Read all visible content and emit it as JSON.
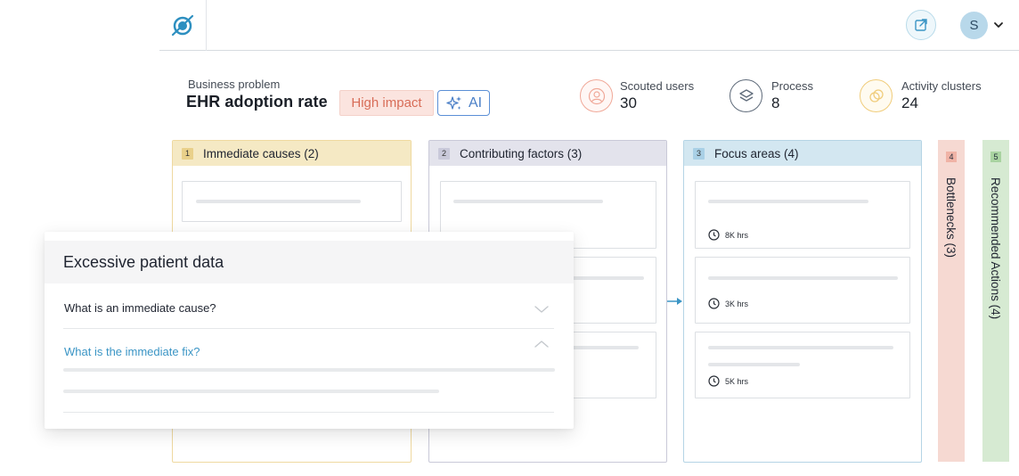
{
  "header": {
    "user_initial": "S"
  },
  "business": {
    "label": "Business problem",
    "title": "EHR adoption rate",
    "impact": "High impact",
    "ai": "AI"
  },
  "stats": [
    {
      "label": "Scouted users",
      "value": "30",
      "icon": "user-icon",
      "color": "#f0a898"
    },
    {
      "label": "Process",
      "value": "8",
      "icon": "layers-icon",
      "color": "#5f6b7a"
    },
    {
      "label": "Activity clusters",
      "value": "24",
      "icon": "clusters-icon",
      "color": "#f0cc7a"
    }
  ],
  "columns": [
    {
      "num": "1",
      "title": "Immediate causes (2)",
      "color": "#f5e9c4",
      "border": "#efd9a0"
    },
    {
      "num": "2",
      "title": "Contributing factors (3)",
      "color": "#e3e3ec",
      "border": "#c9c9d8"
    },
    {
      "num": "3",
      "title": "Focus areas (4)",
      "color": "#d3e7f1",
      "border": "#b5d4e5"
    },
    {
      "num": "4",
      "title": "Bottlenecks (3)",
      "color": "#f6d9d2"
    },
    {
      "num": "5",
      "title": "Recommended Actions (4)",
      "color": "#d6ead2"
    }
  ],
  "focus_cards": [
    {
      "hours": "8K hrs"
    },
    {
      "hours": "3K hrs"
    },
    {
      "hours": "5K hrs"
    }
  ],
  "popup": {
    "title": "Excessive patient data",
    "question_1": "What is an immediate cause?",
    "question_2": "What is the immediate fix?"
  }
}
